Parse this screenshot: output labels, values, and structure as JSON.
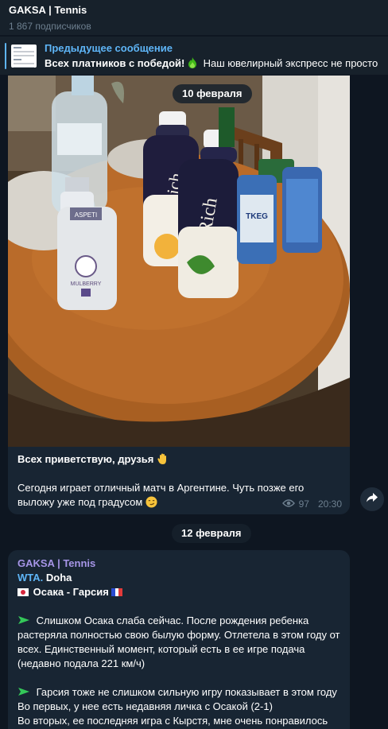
{
  "channel": {
    "title": "GAKSA | Tennis",
    "subscribers": "1 867 подписчиков"
  },
  "pinned": {
    "label": "Предыдущее сообщение",
    "text_bold": "Всех платников с победой!",
    "text_rest": "Наш ювелирный экспресс не просто"
  },
  "messages": [
    {
      "date": "10 февраля",
      "photo_labels": {
        "bottle1": "Rich",
        "bottle2": "Rich",
        "small_bottle_brand": "ASPETI",
        "small_bottle_name": "MULBERRY",
        "can": "TKEG"
      },
      "line1": "Всех приветствую, друзья",
      "line2": "Сегодня играет отличный матч в Аргентине. Чуть позже его выложу уже под градусом",
      "views": "97",
      "time": "20:30"
    },
    {
      "date": "12 февраля",
      "author": "GAKSA | Tennis",
      "tag": "WTA.",
      "tournament": "Doha",
      "match": "Осака - Гарсия",
      "para1": "Слишком Осака слаба сейчас. После рождения ребенка растеряла полностью свою былую форму. Отлетела в этом году от всех. Единственный момент, который есть в ее игре подача (недавно подала 221 км/ч)",
      "para2_line1": "Гарсия тоже не слишком сильную игру показывает в этом году Во первых, у нее есть недавняя личка с Осакой (2-1)",
      "para2_line2": "Во вторых, ее последняя игра с Кырстя, мне очень понравилось"
    }
  ],
  "colors": {
    "background": "#0e1621",
    "header": "#17212b",
    "bubble": "#182533",
    "accent": "#5eb5f7",
    "author": "#a695e7",
    "arrow": "#34c759"
  }
}
